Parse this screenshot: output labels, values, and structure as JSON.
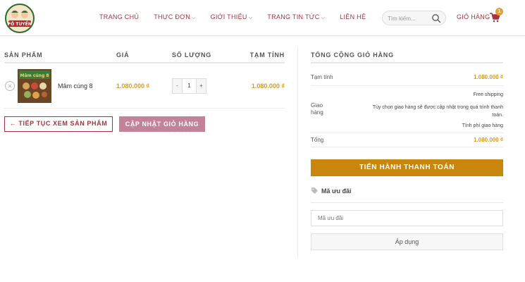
{
  "header": {
    "logo_text": "FÔ TUYỀN",
    "nav": [
      {
        "label": "TRANG CHỦ",
        "has_dropdown": false
      },
      {
        "label": "THỰC ĐƠN",
        "has_dropdown": true
      },
      {
        "label": "GIỚI THIỆU",
        "has_dropdown": true
      },
      {
        "label": "TRANG TIN TỨC",
        "has_dropdown": true
      },
      {
        "label": "LIÊN HỆ",
        "has_dropdown": false
      }
    ],
    "search_placeholder": "Tìm kiếm...",
    "cart_label": "GIỎ HÀNG",
    "cart_count": "1",
    "icons": {
      "search": "search-icon",
      "cart": "cart-icon",
      "dropdown": "chevron-down-icon"
    }
  },
  "cart": {
    "columns": {
      "product": "SẢN PHẨM",
      "price": "GIÁ",
      "quantity": "SỐ LƯỢNG",
      "subtotal": "TẠM TÍNH"
    },
    "items": [
      {
        "name": "Mâm cúng 8",
        "price": "1.080.000 ₫",
        "quantity": "1",
        "subtotal": "1.080.000 ₫",
        "remove_symbol": "×",
        "thumb_text": "Mâm cúng 8"
      }
    ],
    "qty_minus": "-",
    "qty_plus": "+",
    "continue_label": "← TIẾP TỤC XEM SẢN PHẨM",
    "update_label": "CẬP NHẬT GIỎ HÀNG"
  },
  "totals": {
    "title": "TỔNG CỘNG GIỎ HÀNG",
    "subtotal_label": "Tạm tính",
    "subtotal_value": "1.080.000 ₫",
    "shipping_label_1": "Giao",
    "shipping_label_2": "hàng",
    "shipping_method": "Free shipping",
    "shipping_note_1": "Tùy chọn giao hàng sẽ được cập nhật trong quá trình thanh",
    "shipping_note_2": "toán.",
    "shipping_calc": "Tính phí giao hàng",
    "total_label": "Tổng",
    "total_value": "1.080.000 ₫",
    "checkout_label": "TIẾN HÀNH THANH TOÁN"
  },
  "coupon": {
    "heading": "Mã ưu đãi",
    "placeholder": "Mã ưu đãi",
    "apply_label": "Áp dụng"
  },
  "colors": {
    "brand": "#a8333d",
    "price": "#d89a2a",
    "checkout": "#c8860c",
    "update": "#c4829a",
    "badge": "#e3a235"
  }
}
